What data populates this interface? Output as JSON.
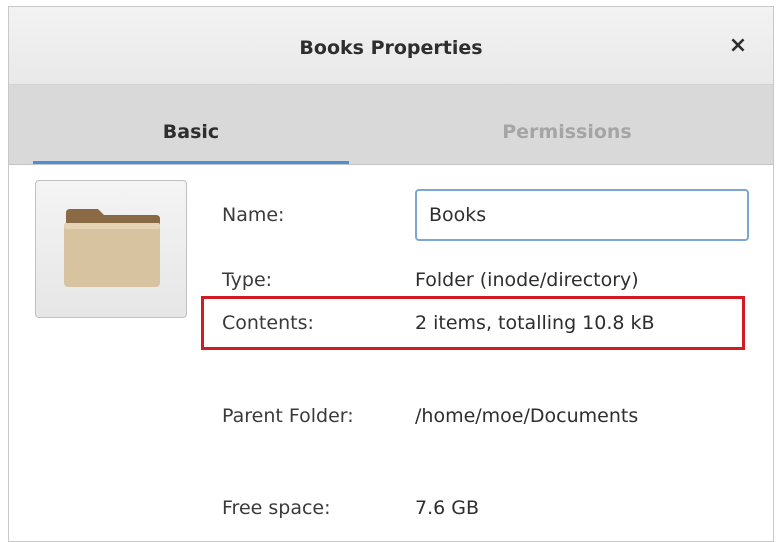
{
  "window": {
    "title": "Books Properties",
    "close_glyph": "×"
  },
  "tabs": [
    {
      "label": "Basic",
      "active": true
    },
    {
      "label": "Permissions",
      "active": false
    }
  ],
  "icon": "folder-icon",
  "fields": {
    "name": {
      "label": "Name:",
      "value": "Books"
    },
    "type": {
      "label": "Type:",
      "value": "Folder (inode/directory)"
    },
    "contents": {
      "label": "Contents:",
      "value": "2 items, totalling 10.8 kB"
    },
    "parent": {
      "label": "Parent Folder:",
      "value": "/home/moe/Documents"
    },
    "free": {
      "label": "Free space:",
      "value": "7.6 GB"
    }
  },
  "colors": {
    "accent": "#4a90d9",
    "highlight": "#d21c24",
    "folder": "#d8c3a0"
  }
}
